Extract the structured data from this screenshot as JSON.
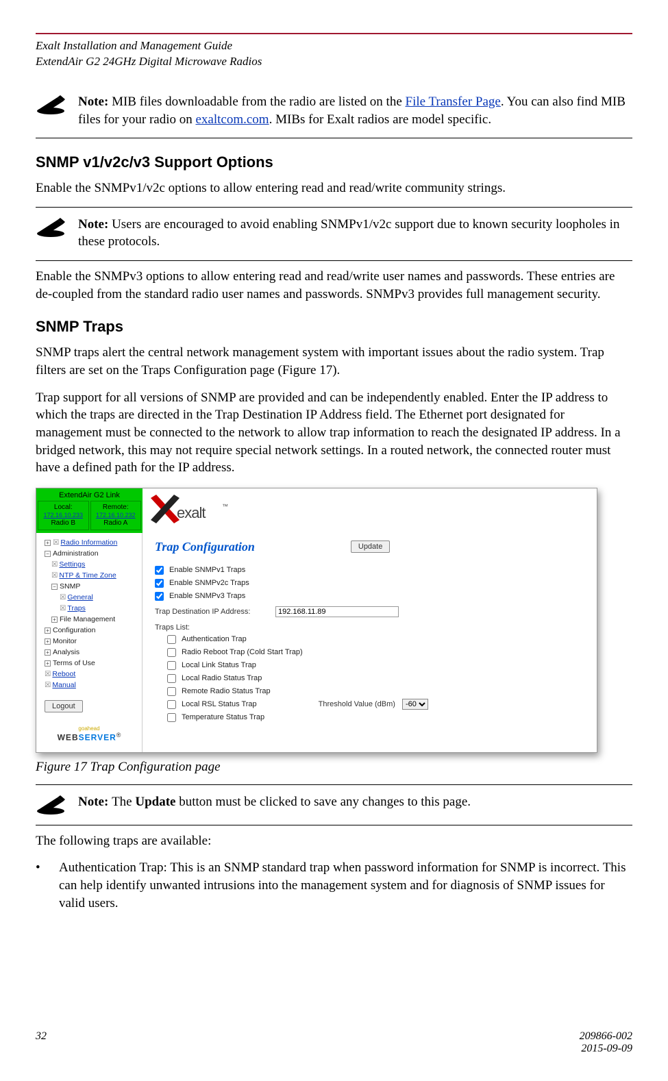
{
  "header": {
    "line1": "Exalt Installation and Management Guide",
    "line2": "ExtendAir G2 24GHz Digital Microwave Radios"
  },
  "note1": {
    "prefix": "Note: ",
    "t1": "MIB files downloadable from the radio are listed on the ",
    "link1": "File Transfer Page",
    "t2": ". You can also find MIB files for your radio on ",
    "link2": "exaltcom.com",
    "t3": ". MIBs for Exalt radios are model specific."
  },
  "sec1": {
    "heading": "SNMP v1/v2c/v3 Support Options",
    "p1": "Enable the SNMPv1/v2c options to allow entering read and read/write community strings."
  },
  "note2": {
    "prefix": "Note: ",
    "text": "Users are encouraged to avoid enabling SNMPv1/v2c support due to known security loopholes in these protocols."
  },
  "p_after_note2": "Enable the SNMPv3 options to allow entering read and read/write user names and passwords. These entries are de-coupled from the standard radio user names and passwords. SNMPv3 provides full management security.",
  "sec2": {
    "heading": "SNMP Traps",
    "p1": "SNMP traps alert the central network management system with important issues about the radio system. Trap filters are set on the Traps Configuration page (Figure 17).",
    "p2": "Trap support for all versions of SNMP are provided and can be independently enabled. Enter the IP address to which the traps are directed in the Trap Destination IP Address field. The Ethernet port designated for management must be connected to the network to allow trap information to reach the designated IP address. In a bridged network, this may not require special network settings. In a routed network, the connected router must have a defined path for the IP address."
  },
  "figure": {
    "caption": "Figure 17   Trap Configuration page",
    "link_title": "ExtendAir G2 Link",
    "local": {
      "label": "Local:",
      "ip": "172.16.10.233",
      "radio": "Radio B"
    },
    "remote": {
      "label": "Remote:",
      "ip": "172.16.10.232",
      "radio": "Radio A"
    },
    "logo_text": "exalt",
    "tree": {
      "radio_info": "Radio Information",
      "admin": "Administration",
      "settings": "Settings",
      "ntp": "NTP & Time Zone",
      "snmp": "SNMP",
      "general": "General",
      "traps": "Traps",
      "file_mgmt": "File Management",
      "config": "Configuration",
      "monitor": "Monitor",
      "analysis": "Analysis",
      "terms": "Terms of Use",
      "reboot": "Reboot",
      "manual": "Manual"
    },
    "logout": "Logout",
    "webserver": {
      "go": "goahead",
      "web": "WEB",
      "server": "SERVER"
    },
    "main": {
      "title": "Trap Configuration",
      "update": "Update",
      "enable_v1": "Enable SNMPv1 Traps",
      "enable_v2": "Enable SNMPv2c Traps",
      "enable_v3": "Enable SNMPv3 Traps",
      "ip_label": "Trap Destination IP Address:",
      "ip_value": "192.168.11.89",
      "list_label": "Traps List:",
      "traps": [
        "Authentication Trap",
        "Radio Reboot Trap (Cold Start Trap)",
        "Local Link Status Trap",
        "Local Radio Status Trap",
        "Remote Radio Status Trap",
        "Local RSL Status Trap",
        "Temperature Status Trap"
      ],
      "threshold_label": "Threshold Value (dBm)",
      "threshold_value": "-60"
    }
  },
  "note3": {
    "prefix": "Note: ",
    "t1": "The ",
    "bold": "Update",
    "t2": " button must be clicked to save any changes to this page."
  },
  "p_after_note3": "The following traps are available:",
  "bullet1": "Authentication Trap: This is an SNMP standard trap when password information for SNMP is incorrect. This can help identify unwanted intrusions into the management system and for diagnosis of SNMP issues for valid users.",
  "footer": {
    "page": "32",
    "doc": "209866-002",
    "date": "2015-09-09"
  }
}
